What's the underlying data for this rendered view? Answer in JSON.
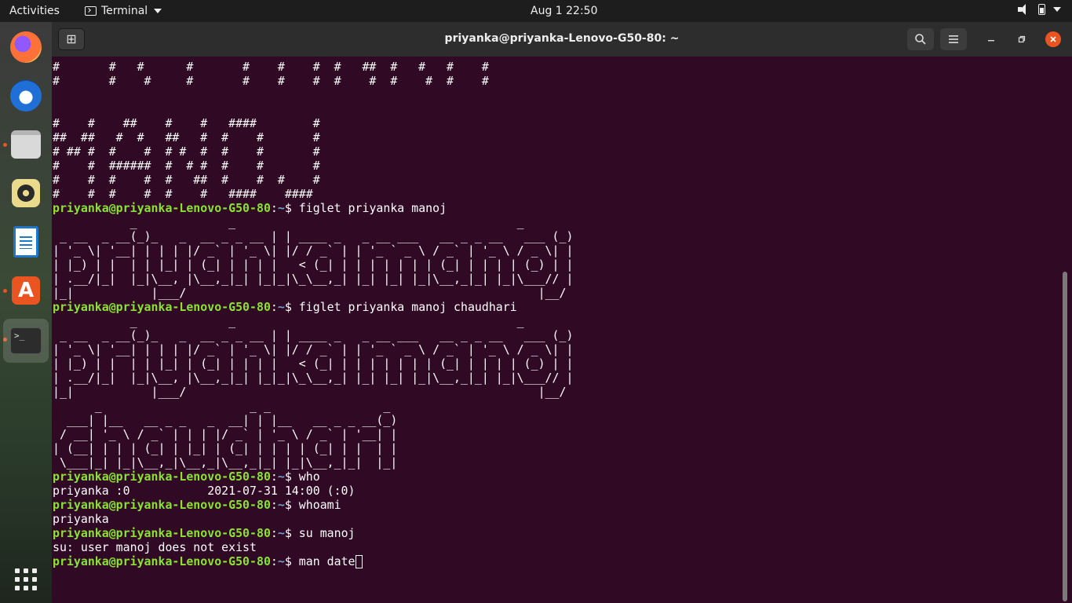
{
  "topbar": {
    "activities": "Activities",
    "app_menu": "Terminal",
    "clock": "Aug 1  22:50"
  },
  "dock": {
    "items": [
      "firefox-icon",
      "thunderbird-icon",
      "files-icon",
      "rhythmbox-icon",
      "libreoffice-writer-icon",
      "ubuntu-software-icon",
      "terminal-icon",
      "show-applications-icon"
    ],
    "store_glyph": "A",
    "terminal_glyph": ">_"
  },
  "window": {
    "title": "priyanka@priyanka-Lenovo-G50-80: ~",
    "new_tab_glyph": "⊞",
    "search_glyph": "🔍",
    "menu_glyph": "☰",
    "minimize_glyph": "–",
    "maximize_glyph": "⧠",
    "close_glyph": "✕"
  },
  "colors": {
    "terminal_bg": "#300a24",
    "prompt_user": "#8ae234",
    "prompt_path": "#729fcf",
    "accent": "#e95420"
  },
  "terminal": {
    "user_host": "priyanka@priyanka-Lenovo-G50-80",
    "colon": ":",
    "path": "~",
    "dollar": "$",
    "block1": "#       #   #      #       #    #    #  #   ##  #   #   #    #\n#       #    #     #       #    #    #  #    #  #    #  #    #\n\n\n#    #    ##    #    #   ####        #\n##  ##   #  #   ##   #  #    #       #\n# ## #  #    #  # #  #  #    #       #\n#    #  ######  #  # #  #    #       #\n#    #  #    #  #   ##  #    #  #    #\n#    #  #    #  #    #   ####    ####\n",
    "cmd1": " figlet priyanka manoj",
    "figlet1": "           _             _                                        _ \n _ __  _ __(_)_   _  __ _ _ __ | | ____ _   _ __ ___   __ _ _ __   ___ (_)\n| '_ \\| '__| | | | |/ _` | '_ \\| |/ / _` | | '_ ` _ \\ / _` | '_ \\ / _ \\| |\n| |_) | |  | | |_| | (_| | | | |   < (_| | | | | | | | (_| | | | | (_) | |\n| .__/|_|  |_|\\__, |\\__,_|_| |_|_|\\_\\__,_| |_| |_| |_|\\__,_|_| |_|\\___// |\n|_|           |___/                                                  |__/ ",
    "cmd2": " figlet priyanka manoj chaudhari",
    "figlet2": "           _             _                                        _ \n _ __  _ __(_)_   _  __ _ _ __ | | ____ _   _ __ ___   __ _ _ __   ___ (_)\n| '_ \\| '__| | | | |/ _` | '_ \\| |/ / _` | | '_ ` _ \\ / _` | '_ \\ / _ \\| |\n| |_) | |  | | |_| | (_| | | | |   < (_| | | | | | | | (_| | | | | (_) | |\n| .__/|_|  |_|\\__, |\\__,_|_| |_|_|\\_\\__,_| |_| |_| |_|\\__,_|_| |_|\\___// |\n|_|           |___/                                                  |__/ \n      _                     _ _                _ \n  ___| |__   __ _ _   _  __| | |__   __ _ _ __(_)\n / __| '_ \\ / _` | | | |/ _` | '_ \\ / _` | '__| |\n| (__| | | | (_| | |_| | (_| | | | | (_| | |  | |\n \\___|_| |_|\\__,_|\\__,_|\\__,_|_| |_|\\__,_|_|  |_|\n",
    "cmd3": " who",
    "out3": "priyanka :0           2021-07-31 14:00 (:0)",
    "cmd4": " whoami",
    "out4": "priyanka",
    "cmd5": " su manoj",
    "out5": "su: user manoj does not exist",
    "cmd6": " man date"
  }
}
